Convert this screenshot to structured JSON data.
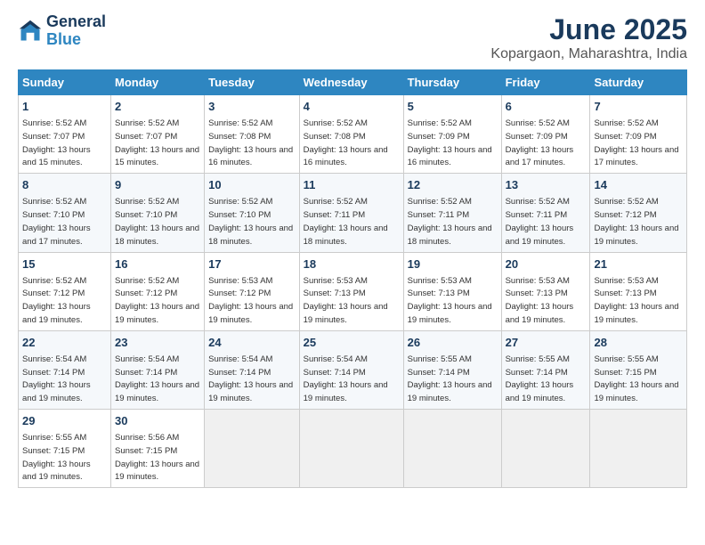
{
  "logo": {
    "line1": "General",
    "line2": "Blue"
  },
  "title": "June 2025",
  "subtitle": "Kopargaon, Maharashtra, India",
  "days_of_week": [
    "Sunday",
    "Monday",
    "Tuesday",
    "Wednesday",
    "Thursday",
    "Friday",
    "Saturday"
  ],
  "weeks": [
    [
      {
        "day": "1",
        "sunrise": "5:52 AM",
        "sunset": "7:07 PM",
        "daylight": "13 hours and 15 minutes."
      },
      {
        "day": "2",
        "sunrise": "5:52 AM",
        "sunset": "7:07 PM",
        "daylight": "13 hours and 15 minutes."
      },
      {
        "day": "3",
        "sunrise": "5:52 AM",
        "sunset": "7:08 PM",
        "daylight": "13 hours and 16 minutes."
      },
      {
        "day": "4",
        "sunrise": "5:52 AM",
        "sunset": "7:08 PM",
        "daylight": "13 hours and 16 minutes."
      },
      {
        "day": "5",
        "sunrise": "5:52 AM",
        "sunset": "7:09 PM",
        "daylight": "13 hours and 16 minutes."
      },
      {
        "day": "6",
        "sunrise": "5:52 AM",
        "sunset": "7:09 PM",
        "daylight": "13 hours and 17 minutes."
      },
      {
        "day": "7",
        "sunrise": "5:52 AM",
        "sunset": "7:09 PM",
        "daylight": "13 hours and 17 minutes."
      }
    ],
    [
      {
        "day": "8",
        "sunrise": "5:52 AM",
        "sunset": "7:10 PM",
        "daylight": "13 hours and 17 minutes."
      },
      {
        "day": "9",
        "sunrise": "5:52 AM",
        "sunset": "7:10 PM",
        "daylight": "13 hours and 18 minutes."
      },
      {
        "day": "10",
        "sunrise": "5:52 AM",
        "sunset": "7:10 PM",
        "daylight": "13 hours and 18 minutes."
      },
      {
        "day": "11",
        "sunrise": "5:52 AM",
        "sunset": "7:11 PM",
        "daylight": "13 hours and 18 minutes."
      },
      {
        "day": "12",
        "sunrise": "5:52 AM",
        "sunset": "7:11 PM",
        "daylight": "13 hours and 18 minutes."
      },
      {
        "day": "13",
        "sunrise": "5:52 AM",
        "sunset": "7:11 PM",
        "daylight": "13 hours and 19 minutes."
      },
      {
        "day": "14",
        "sunrise": "5:52 AM",
        "sunset": "7:12 PM",
        "daylight": "13 hours and 19 minutes."
      }
    ],
    [
      {
        "day": "15",
        "sunrise": "5:52 AM",
        "sunset": "7:12 PM",
        "daylight": "13 hours and 19 minutes."
      },
      {
        "day": "16",
        "sunrise": "5:52 AM",
        "sunset": "7:12 PM",
        "daylight": "13 hours and 19 minutes."
      },
      {
        "day": "17",
        "sunrise": "5:53 AM",
        "sunset": "7:12 PM",
        "daylight": "13 hours and 19 minutes."
      },
      {
        "day": "18",
        "sunrise": "5:53 AM",
        "sunset": "7:13 PM",
        "daylight": "13 hours and 19 minutes."
      },
      {
        "day": "19",
        "sunrise": "5:53 AM",
        "sunset": "7:13 PM",
        "daylight": "13 hours and 19 minutes."
      },
      {
        "day": "20",
        "sunrise": "5:53 AM",
        "sunset": "7:13 PM",
        "daylight": "13 hours and 19 minutes."
      },
      {
        "day": "21",
        "sunrise": "5:53 AM",
        "sunset": "7:13 PM",
        "daylight": "13 hours and 19 minutes."
      }
    ],
    [
      {
        "day": "22",
        "sunrise": "5:54 AM",
        "sunset": "7:14 PM",
        "daylight": "13 hours and 19 minutes."
      },
      {
        "day": "23",
        "sunrise": "5:54 AM",
        "sunset": "7:14 PM",
        "daylight": "13 hours and 19 minutes."
      },
      {
        "day": "24",
        "sunrise": "5:54 AM",
        "sunset": "7:14 PM",
        "daylight": "13 hours and 19 minutes."
      },
      {
        "day": "25",
        "sunrise": "5:54 AM",
        "sunset": "7:14 PM",
        "daylight": "13 hours and 19 minutes."
      },
      {
        "day": "26",
        "sunrise": "5:55 AM",
        "sunset": "7:14 PM",
        "daylight": "13 hours and 19 minutes."
      },
      {
        "day": "27",
        "sunrise": "5:55 AM",
        "sunset": "7:14 PM",
        "daylight": "13 hours and 19 minutes."
      },
      {
        "day": "28",
        "sunrise": "5:55 AM",
        "sunset": "7:15 PM",
        "daylight": "13 hours and 19 minutes."
      }
    ],
    [
      {
        "day": "29",
        "sunrise": "5:55 AM",
        "sunset": "7:15 PM",
        "daylight": "13 hours and 19 minutes."
      },
      {
        "day": "30",
        "sunrise": "5:56 AM",
        "sunset": "7:15 PM",
        "daylight": "13 hours and 19 minutes."
      },
      null,
      null,
      null,
      null,
      null
    ]
  ]
}
